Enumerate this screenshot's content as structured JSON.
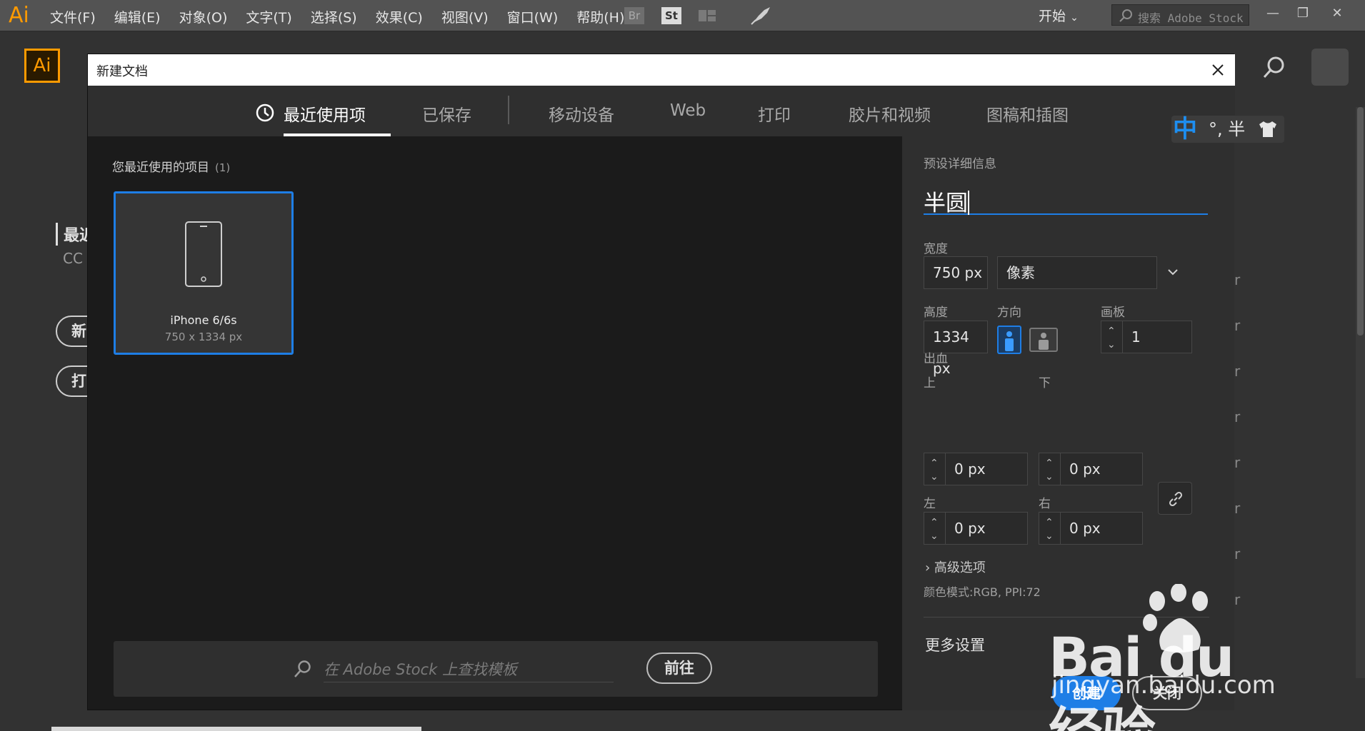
{
  "menubar": {
    "app_logo": "Ai",
    "menus": [
      "文件(F)",
      "编辑(E)",
      "对象(O)",
      "文字(T)",
      "选择(S)",
      "效果(C)",
      "视图(V)",
      "窗口(W)",
      "帮助(H)"
    ],
    "bridge_label": "Br",
    "stock_label": "St",
    "workspace": "开始",
    "search_placeholder": "搜索 Adobe Stock"
  },
  "home": {
    "logo": "Ai",
    "recent_label": "最近",
    "cc_label": "CC",
    "new_button": "新",
    "open_button": "打",
    "right_rows": [
      "r",
      "r",
      "r",
      "r",
      "r",
      "r",
      "r",
      "r"
    ]
  },
  "dialog": {
    "title": "新建文档",
    "tabs": [
      "最近使用项",
      "已保存",
      "移动设备",
      "Web",
      "打印",
      "胶片和视频",
      "图稿和插图"
    ],
    "active_tab": "最近使用项",
    "recent_heading": "您最近使用的项目",
    "recent_count": "(1)",
    "preset_card": {
      "name": "iPhone 6/6s",
      "size": "750 x 1334 px"
    },
    "stock_search_placeholder": "在 Adobe Stock 上查找模板",
    "go_button": "前往"
  },
  "details": {
    "heading": "预设详细信息",
    "preset_name": "半圆",
    "width_label": "宽度",
    "width_value": "750 px",
    "unit": "像素",
    "height_label": "高度",
    "height_value": "1334 px",
    "orientation_label": "方向",
    "artboards_label": "画板",
    "artboards_value": "1",
    "bleed_label": "出血",
    "bleed_top_label": "上",
    "bleed_top": "0 px",
    "bleed_bottom_label": "下",
    "bleed_bottom": "0 px",
    "bleed_left_label": "左",
    "bleed_left": "0 px",
    "bleed_right_label": "右",
    "bleed_right": "0 px",
    "advanced_label": "高级选项",
    "color_mode": "颜色模式:RGB, PPI:72",
    "more_settings": "更多设置",
    "create_button": "创建",
    "close_button": "关闭"
  },
  "ime": {
    "mode": "中",
    "extra": "°, 半"
  },
  "watermark": {
    "text": "Bai du 经验",
    "url": "jingyan.baidu.com"
  },
  "colors": {
    "accent": "#1e7ee6",
    "brand": "#ff9a00",
    "dialog_bg": "#1b1b1b",
    "panel_bg": "#2f2f2f"
  }
}
